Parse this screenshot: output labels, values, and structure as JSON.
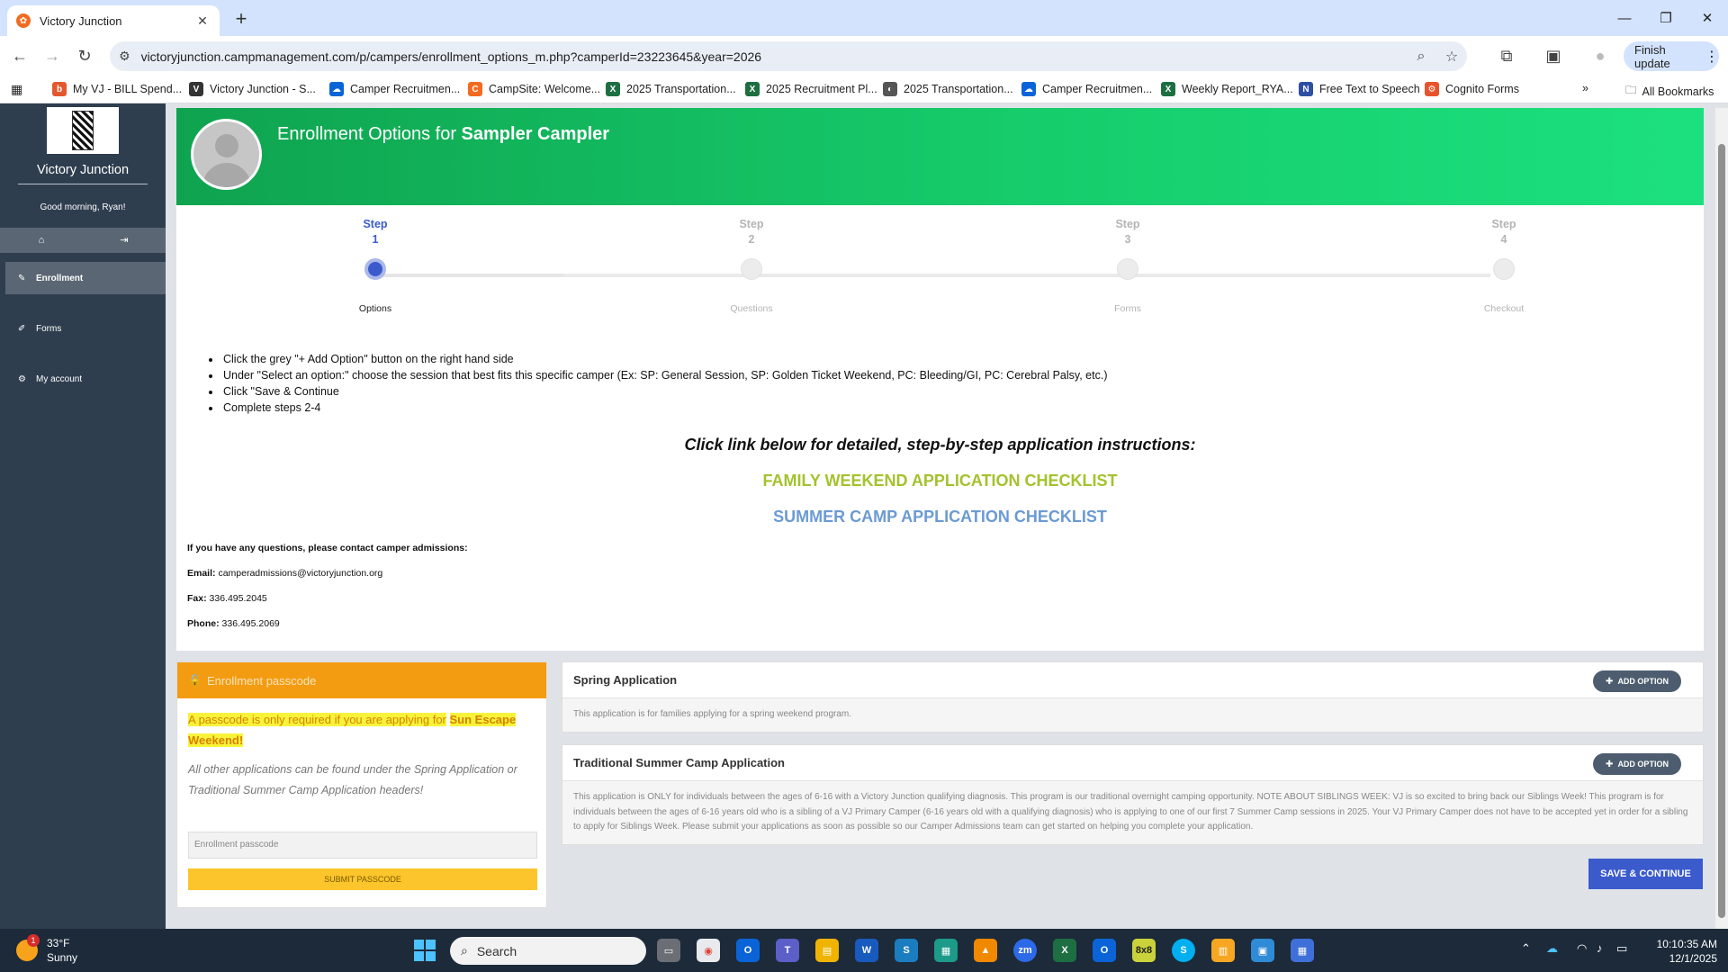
{
  "browser": {
    "tab_title": "Victory Junction",
    "url": "victoryjunction.campmanagement.com/p/campers/enrollment_options_m.php?camperId=23223645&year=2026",
    "finish_update": "Finish update",
    "bookmarks": [
      {
        "label": "My VJ - BILL Spend...",
        "icon": "bill-icon",
        "color": "#e4572e",
        "glyph": "b"
      },
      {
        "label": "Victory Junction - S...",
        "icon": "victory-junction-icon",
        "color": "#333333",
        "glyph": "V"
      },
      {
        "label": "Camper Recruitmen...",
        "icon": "onedrive-icon",
        "color": "#0a64d8",
        "glyph": "☁"
      },
      {
        "label": "CampSite: Welcome...",
        "icon": "campsite-icon",
        "color": "#f26b21",
        "glyph": "C"
      },
      {
        "label": "2025 Transportation...",
        "icon": "excel-icon",
        "color": "#1d6f42",
        "glyph": "X"
      },
      {
        "label": "2025 Recruitment Pl...",
        "icon": "excel-icon",
        "color": "#1d6f42",
        "glyph": "X"
      },
      {
        "label": "2025 Transportation...",
        "icon": "globe-icon",
        "color": "#555555",
        "glyph": "◐"
      },
      {
        "label": "Camper Recruitmen...",
        "icon": "onedrive-icon",
        "color": "#0a64d8",
        "glyph": "☁"
      },
      {
        "label": "Weekly Report_RYA...",
        "icon": "excel-icon",
        "color": "#1d6f42",
        "glyph": "X"
      },
      {
        "label": "Free Text to Speech",
        "icon": "naturalreader-icon",
        "color": "#2e4fa3",
        "glyph": "N"
      },
      {
        "label": "Cognito Forms",
        "icon": "cognito-icon",
        "color": "#e8532b",
        "glyph": "⚙"
      }
    ],
    "more_bookmarks": "»",
    "all_bookmarks": "All Bookmarks"
  },
  "sidebar": {
    "org_name": "Victory Junction",
    "greeting": "Good morning, Ryan!",
    "items": [
      {
        "label": "Enrollment",
        "icon": "pencil-icon",
        "glyph": "✎",
        "active": true
      },
      {
        "label": "Forms",
        "icon": "edit-form-icon",
        "glyph": "✐",
        "active": false
      },
      {
        "label": "My account",
        "icon": "gear-icon",
        "glyph": "⚙",
        "active": false
      }
    ]
  },
  "hero": {
    "title_prefix": "Enrollment Options for",
    "camper_name": "Sampler Campler"
  },
  "steps": [
    {
      "label": "Step",
      "number": "1",
      "name": "Options",
      "active": true
    },
    {
      "label": "Step",
      "number": "2",
      "name": "Questions",
      "active": false
    },
    {
      "label": "Step",
      "number": "3",
      "name": "Forms",
      "active": false
    },
    {
      "label": "Step",
      "number": "4",
      "name": "Checkout",
      "active": false
    }
  ],
  "instructions": [
    "Click the grey \"+ Add Option\" button on the right hand side",
    "Under \"Select an option:\" choose the session that best fits this specific camper (Ex: SP: General Session, SP: Golden Ticket Weekend, PC: Bleeding/GI, PC: Cerebral Palsy, etc.)",
    "Click \"Save & Continue",
    "Complete steps 2-4"
  ],
  "links": {
    "heading": "Click link below for detailed, step-by-step application instructions:",
    "family": "FAMILY WEEKEND APPLICATION CHECKLIST",
    "summer": "SUMMER CAMP APPLICATION CHECKLIST"
  },
  "contact": {
    "intro": "If you have any questions, please contact camper admissions:",
    "email_label": "Email:",
    "email": "camperadmissions@victoryjunction.org",
    "fax_label": "Fax:",
    "fax": "336.495.2045",
    "phone_label": "Phone:",
    "phone": "336.495.2069"
  },
  "passcode": {
    "title": "Enrollment passcode",
    "note": "A passcode is only required if you are applying for",
    "note_bold": "Sun Escape Weekend!",
    "sub": "All other applications can be found under the Spring Application or Traditional Summer Camp Application headers!",
    "placeholder": "Enrollment passcode",
    "submit": "SUBMIT PASSCODE"
  },
  "applications": [
    {
      "title": "Spring Application",
      "button": "ADD OPTION",
      "description": "This application is for families applying for a spring weekend program."
    },
    {
      "title": "Traditional Summer Camp Application",
      "button": "ADD OPTION",
      "description": "This application is ONLY for individuals between the ages of 6-16 with a Victory Junction qualifying diagnosis. This program is our traditional overnight camping opportunity. NOTE ABOUT SIBLINGS WEEK: VJ is so excited to bring back our Siblings Week! This program is for individuals between the ages of 6-16 years old who is a sibling of a VJ Primary Camper (6-16 years old with a qualifying diagnosis) who is applying to one of our first 7 Summer Camp sessions in 2025. Your VJ Primary Camper does not have to be accepted yet in order for a sibling to apply for Siblings Week. Please submit your applications as soon as possible so our Camper Admissions team can get started on helping you complete your application."
    }
  ],
  "save_continue": "SAVE & CONTINUE",
  "taskbar": {
    "temperature": "33°F",
    "condition": "Sunny",
    "weather_badge": "1",
    "search": "Search",
    "time": "10:10:35 AM",
    "date": "12/1/2025"
  },
  "colors": {
    "hero_green": "#16cc6b",
    "accent_blue": "#3b5bcc",
    "passcode_orange": "#f39c12",
    "family_link": "#a3c22d",
    "summer_link": "#6b9ad3"
  }
}
